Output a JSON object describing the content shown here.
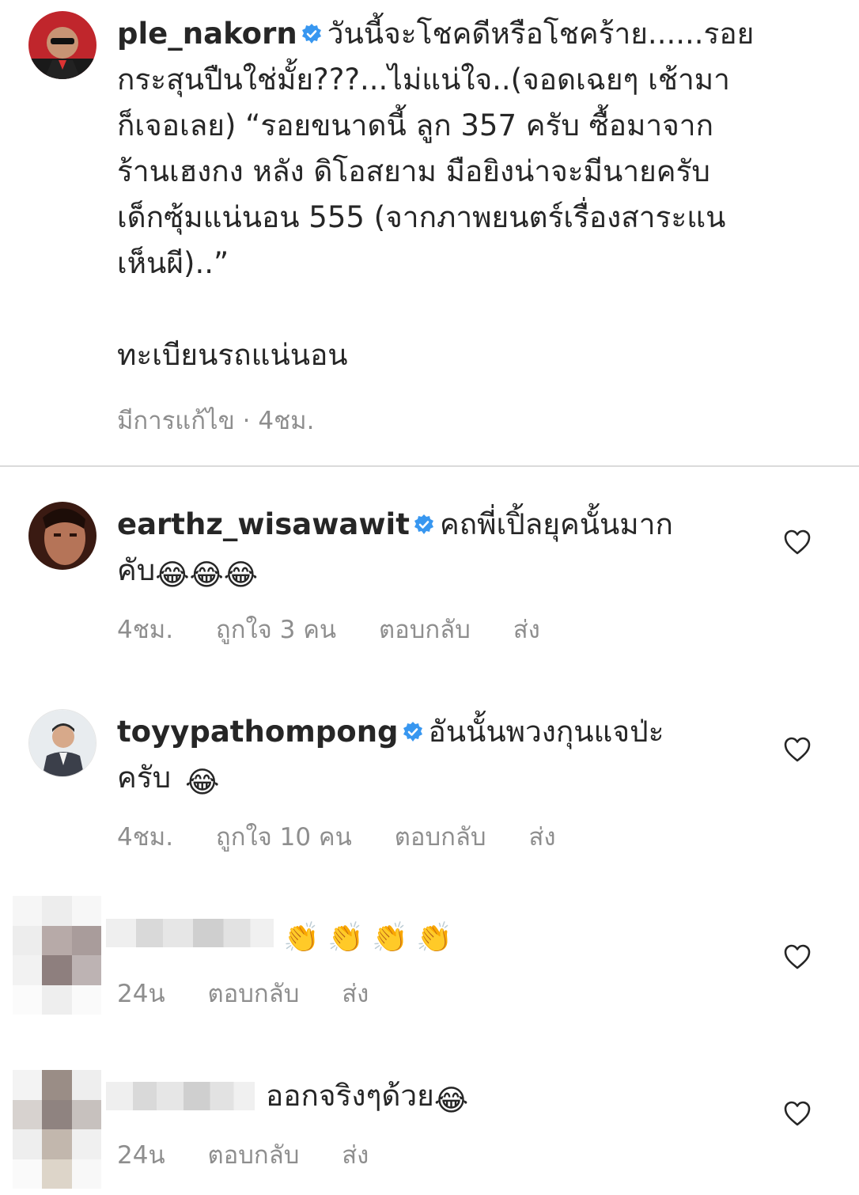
{
  "post": {
    "username": "ple_nakorn",
    "caption_lines": [
      "วันนี้จะโชคดีหรือโชคร้าย......รอย",
      "กระสุนปืนใช่มั้ย???...ไม่แน่ใจ..(จอดเฉยๆ เช้ามา",
      "ก็เจอเลย) “รอยขนาดนี้ ลูก 357 ครับ ซื้อมาจาก",
      "ร้านเฮงกง หลัง ดิโอสยาม มือยิงน่าจะมีนายครับ",
      "เด็กซุ้มแน่นอน  555 (จากภาพยนตร์เรื่องสาระแน",
      "เห็นผี)..”"
    ],
    "caption_extra": "ทะเบียนรถแน่นอน",
    "edited_label": "มีการแก้ไข",
    "time": "4ชม."
  },
  "comments": [
    {
      "username": "earthz_wisawawit",
      "text_line1": "คถพี่เปิ้ลยุคนั้นมาก",
      "text_line2": "คับ",
      "emoji": "😂😂😂",
      "time": "4ชม.",
      "likes": "ถูกใจ 3 คน",
      "reply": "ตอบกลับ",
      "send": "ส่ง"
    },
    {
      "username": "toyypathompong",
      "text_line1": "อันนั้นพวงกุนแจป่ะ",
      "text_line2": "ครับ",
      "emoji": "😂",
      "time": "4ชม.",
      "likes": "ถูกใจ 10 คน",
      "reply": "ตอบกลับ",
      "send": "ส่ง"
    },
    {
      "emoji": "👏👏👏👏",
      "time": "24น",
      "reply": "ตอบกลับ",
      "send": "ส่ง"
    },
    {
      "text": "ออกจริงๆด้วย",
      "emoji": "😂",
      "time": "24น",
      "reply": "ตอบกลับ",
      "send": "ส่ง"
    }
  ],
  "colors": {
    "verified": "#3897f0",
    "meta": "#8e8e8e",
    "divider": "#dbdbdb"
  }
}
